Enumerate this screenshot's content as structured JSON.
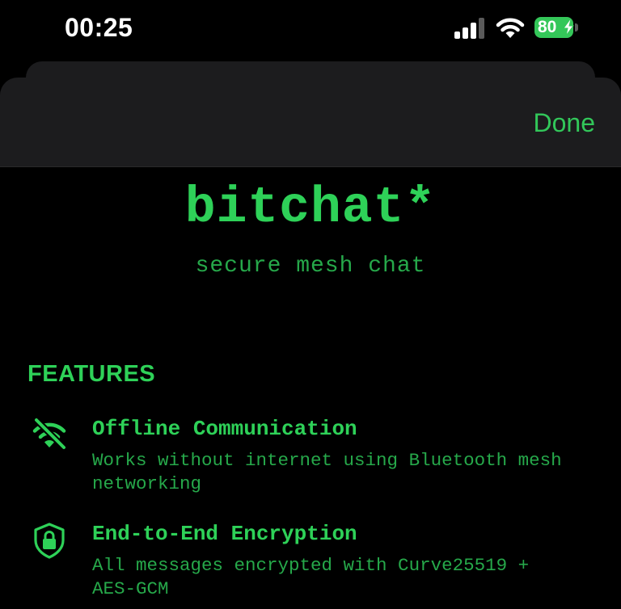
{
  "status_bar": {
    "time": "00:25",
    "battery_level": "80",
    "signal_bars_active": 3,
    "signal_bars_total": 4
  },
  "sheet": {
    "done_label": "Done"
  },
  "app": {
    "title": "bitchat*",
    "subtitle": "secure mesh chat"
  },
  "features": {
    "header": "FEATURES",
    "items": [
      {
        "icon": "wifi-off-icon",
        "title": "Offline Communication",
        "description": "Works without internet using Bluetooth mesh networking"
      },
      {
        "icon": "lock-shield-icon",
        "title": "End-to-End Encryption",
        "description": "All messages encrypted with Curve25519 + AES-GCM"
      }
    ]
  },
  "colors": {
    "accent": "#2ed158",
    "accent_dim": "#26a84a",
    "background": "#000000",
    "sheet_header": "#1c1c1e"
  }
}
